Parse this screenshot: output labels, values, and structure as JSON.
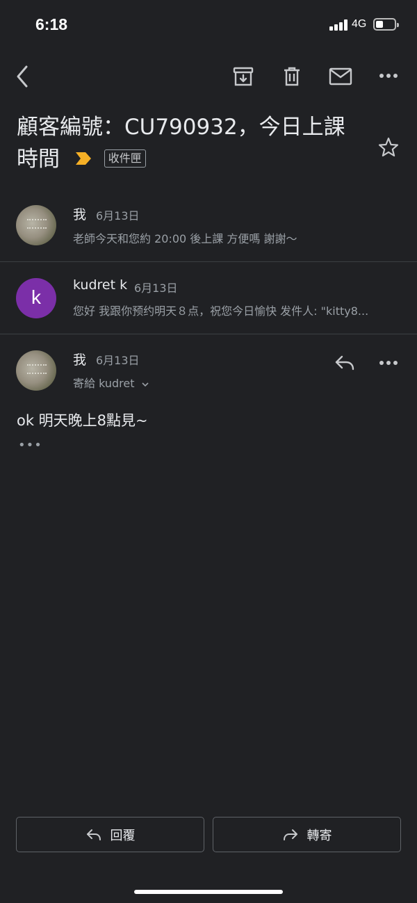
{
  "status_bar": {
    "time": "6:18",
    "network": "4G",
    "battery_level": 0.35
  },
  "toolbar": {
    "back_icon": "chevron-left-icon",
    "archive_icon": "archive-icon",
    "delete_icon": "trash-icon",
    "mark_unread_icon": "mail-icon",
    "more_icon": "more-horizontal-icon"
  },
  "subject": {
    "text": "顧客編號：CU790932，今日上課時間",
    "label_chip": "收件匣",
    "star_icon": "star-outline-icon",
    "importance_color": "#f6b026"
  },
  "messages": [
    {
      "sender": "我",
      "date": "6月13日",
      "snippet": "老師今天和您約 20:00 後上課 方便嗎 謝謝～"
    },
    {
      "sender": "kudret k",
      "avatar_letter": "k",
      "avatar_color": "#7b2fa8",
      "date": "6月13日",
      "snippet": "您好 我跟你预约明天８点，祝您今日愉快 发件人: \"kitty8..."
    },
    {
      "sender": "我",
      "date": "6月13日",
      "recipient": "寄給 kudret",
      "body": "ok 明天晚上8點見~",
      "trimmed": "•••"
    }
  ],
  "actions": {
    "reply_label": "回覆",
    "forward_label": "轉寄"
  }
}
